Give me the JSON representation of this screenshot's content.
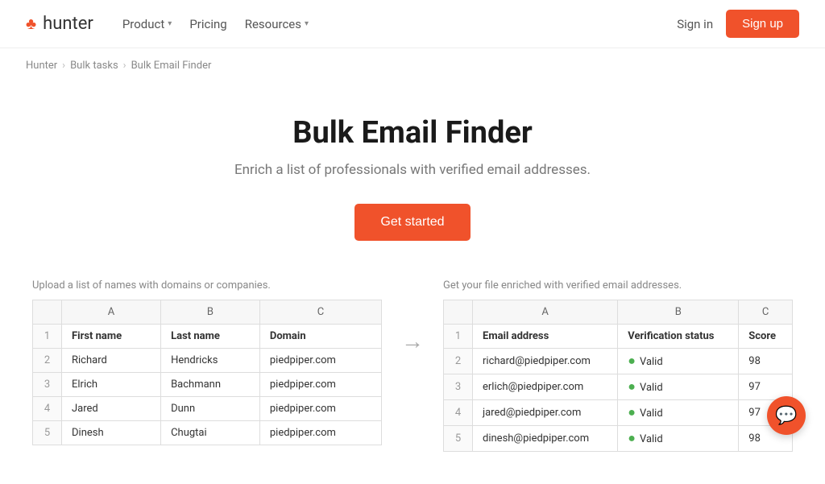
{
  "nav": {
    "logo_icon": "♣",
    "logo_text": "hunter",
    "links": [
      {
        "label": "Product",
        "has_chevron": true
      },
      {
        "label": "Pricing",
        "has_chevron": false
      },
      {
        "label": "Resources",
        "has_chevron": true
      }
    ],
    "sign_in": "Sign in",
    "sign_up": "Sign up"
  },
  "breadcrumb": {
    "items": [
      "Hunter",
      "Bulk tasks",
      "Bulk Email Finder"
    ]
  },
  "hero": {
    "title": "Bulk Email Finder",
    "subtitle": "Enrich a list of professionals with verified email addresses.",
    "cta": "Get started"
  },
  "left_table": {
    "caption": "Upload a list of names with domains or companies.",
    "col_headers": [
      "",
      "A",
      "B",
      "C"
    ],
    "row_header": [
      "",
      "First name",
      "Last name",
      "Domain"
    ],
    "rows": [
      {
        "num": "2",
        "a": "Richard",
        "b": "Hendricks",
        "c": "piedpiper.com"
      },
      {
        "num": "3",
        "a": "Elrich",
        "b": "Bachmann",
        "c": "piedpiper.com"
      },
      {
        "num": "4",
        "a": "Jared",
        "b": "Dunn",
        "c": "piedpiper.com"
      },
      {
        "num": "5",
        "a": "Dinesh",
        "b": "Chugtai",
        "c": "piedpiper.com"
      }
    ]
  },
  "right_table": {
    "caption": "Get your file enriched with verified email addresses.",
    "col_headers": [
      "",
      "A",
      "B",
      "C"
    ],
    "row_header": [
      "",
      "Email address",
      "Verification status",
      "Score"
    ],
    "rows": [
      {
        "num": "2",
        "a": "richard@piedpiper.com",
        "b": "Valid",
        "c": "98"
      },
      {
        "num": "3",
        "a": "erlich@piedpiper.com",
        "b": "Valid",
        "c": "97"
      },
      {
        "num": "4",
        "a": "jared@piedpiper.com",
        "b": "Valid",
        "c": "97"
      },
      {
        "num": "5",
        "a": "dinesh@piedpiper.com",
        "b": "Valid",
        "c": "98"
      }
    ]
  },
  "chat": {
    "icon": "💬"
  }
}
